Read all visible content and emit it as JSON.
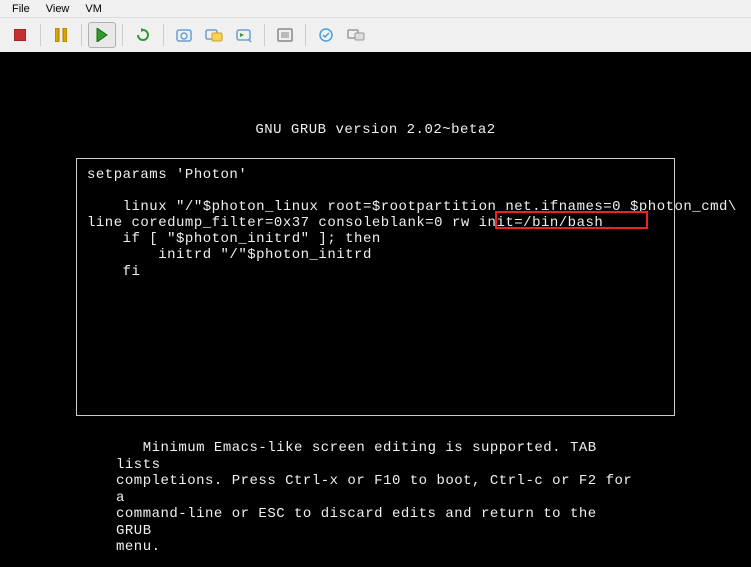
{
  "menu": {
    "file": "File",
    "view": "View",
    "vm": "VM"
  },
  "toolbar_icons": {
    "stop": "stop-icon",
    "pause": "pause-icon",
    "play": "play-icon",
    "cycle": "cycle-icon",
    "snapshot": "snapshot-icon",
    "snapshot_manager": "snapshot-manager-icon",
    "snapshot_revert": "snapshot-revert-icon",
    "fullscreen": "fullscreen-icon",
    "unity": "unity-icon",
    "devices": "devices-icon"
  },
  "grub": {
    "title": "GNU GRUB  version 2.02~beta2",
    "line1": "setparams 'Photon'",
    "line2": "",
    "line3": "    linux \"/\"$photon_linux root=$rootpartition net.ifnames=0 $photon_cmd\\",
    "line4": "line coredump_filter=0x37 consoleblank=0 rw init=/bin/bash_",
    "line5": "    if [ \"$photon_initrd\" ]; then",
    "line6": "        initrd \"/\"$photon_initrd",
    "line7": "    fi",
    "highlighted": "rw init=/bin/bash_",
    "help": "   Minimum Emacs-like screen editing is supported. TAB lists\ncompletions. Press Ctrl-x or F10 to boot, Ctrl-c or F2 for a\ncommand-line or ESC to discard edits and return to the GRUB\nmenu."
  }
}
